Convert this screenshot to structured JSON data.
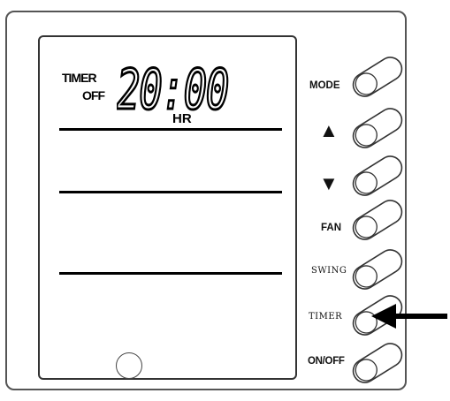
{
  "display": {
    "timer_label": "TIMER",
    "off_label": "OFF",
    "time": "20:00",
    "unit": "HR"
  },
  "buttons": {
    "mode": "MODE",
    "up": "▲",
    "down": "▼",
    "fan": "FAN",
    "swing": "SWING",
    "timer": "TIMER",
    "on_off": "ON/OFF"
  },
  "colors": {
    "ink": "#000000",
    "frame": "#555555"
  },
  "icons": [
    "up-arrow-icon",
    "down-arrow-icon",
    "pointer-arrow-icon"
  ]
}
